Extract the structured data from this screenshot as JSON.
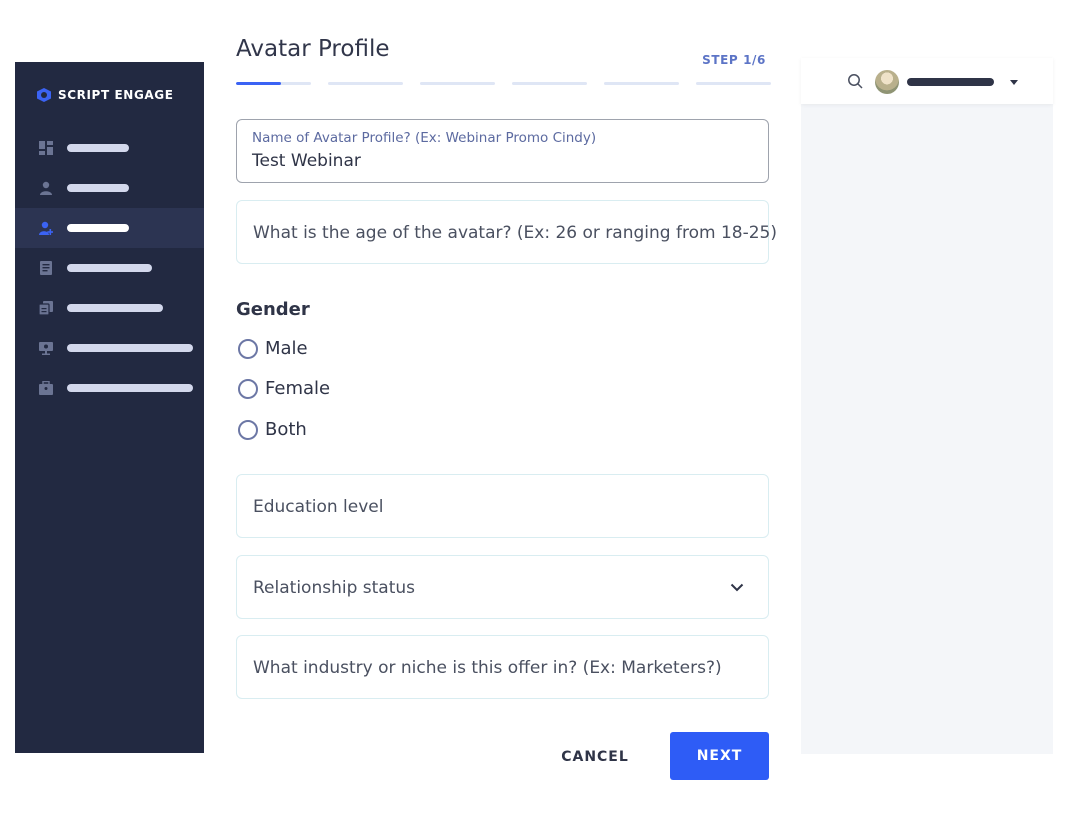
{
  "brand": {
    "name": "SCRIPT ENGAGE",
    "accent": "#3b63f4"
  },
  "sidebar": {
    "items": [
      {
        "icon": "dashboard-icon",
        "active": false
      },
      {
        "icon": "user-icon",
        "active": false
      },
      {
        "icon": "add-user-icon",
        "active": true
      },
      {
        "icon": "document-icon",
        "active": false
      },
      {
        "icon": "copy-icon",
        "active": false
      },
      {
        "icon": "presentation-icon",
        "active": false
      },
      {
        "icon": "briefcase-icon",
        "active": false
      }
    ]
  },
  "main": {
    "title": "Avatar Profile",
    "step": "STEP 1/6",
    "progress": {
      "current": 1,
      "total": 6,
      "first_segment_fill": 0.6
    },
    "fields": {
      "name": {
        "label": "Name of Avatar Profile? (Ex: Webinar Promo Cindy)",
        "value": "Test Webinar"
      },
      "age": {
        "placeholder": "What is the age of the avatar? (Ex: 26 or ranging from 18-25)"
      },
      "education": {
        "placeholder": "Education level"
      },
      "relationship": {
        "placeholder": "Relationship status"
      },
      "industry": {
        "placeholder": "What industry or niche is this offer in? (Ex: Marketers?)"
      }
    },
    "gender": {
      "title": "Gender",
      "options": [
        "Male",
        "Female",
        "Both"
      ],
      "selected": null
    },
    "buttons": {
      "cancel": "CANCEL",
      "next": "NEXT"
    }
  },
  "topbar": {
    "search_icon": "search-icon",
    "avatar": "avatar",
    "dropdown_icon": "caret-down-icon"
  }
}
